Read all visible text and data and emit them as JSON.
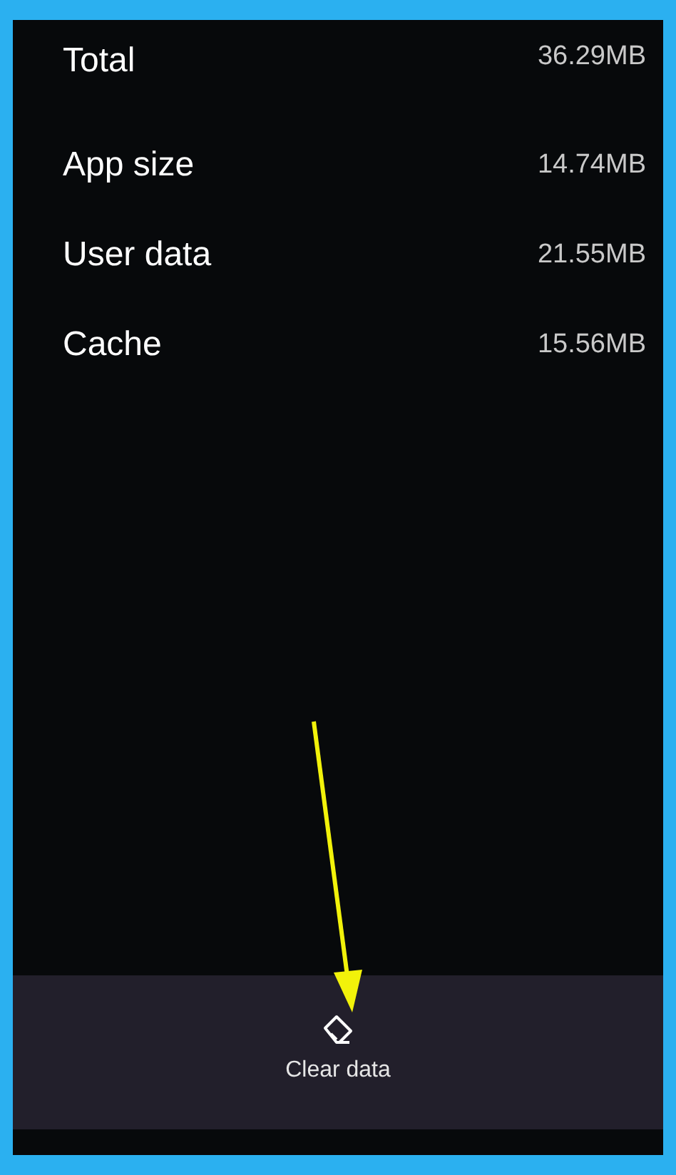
{
  "storage_rows": [
    {
      "label": "Total",
      "value": "36.29MB"
    },
    {
      "label": "App size",
      "value": "14.74MB"
    },
    {
      "label": "User data",
      "value": "21.55MB"
    },
    {
      "label": "Cache",
      "value": "15.56MB"
    }
  ],
  "bottom_bar": {
    "action": {
      "label": "Clear data"
    }
  }
}
